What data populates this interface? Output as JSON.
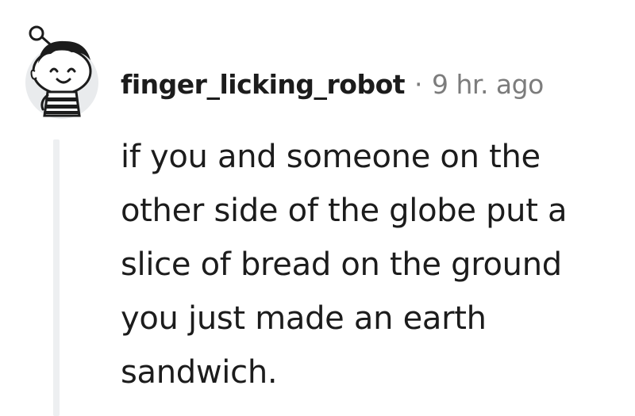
{
  "comment": {
    "author": "finger_licking_robot",
    "separator": "·",
    "timestamp": "9 hr. ago",
    "body_lines": [
      "if you and someone on the",
      "other side of the globe put a",
      "slice of bread on the ground",
      "you just made an earth",
      "sandwich."
    ]
  },
  "icons": {
    "avatar": "snoo-avatar-icon"
  },
  "colors": {
    "text": "#1c1c1c",
    "meta_text": "#7c7c7c",
    "thread_line": "#edeff1",
    "avatar_bg": "#e9ebed"
  }
}
